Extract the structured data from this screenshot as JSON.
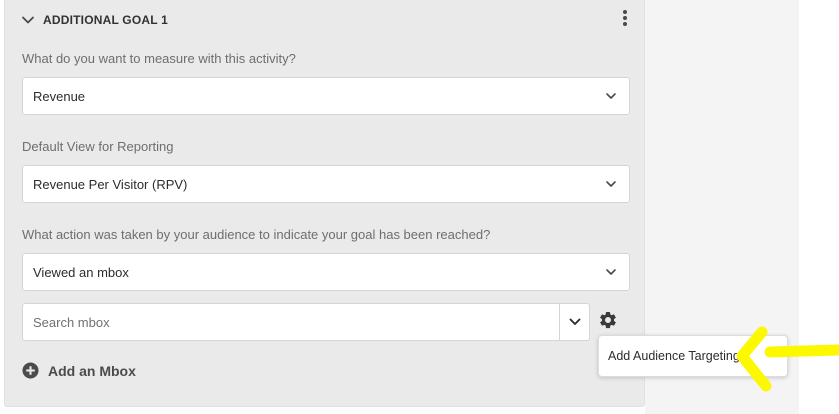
{
  "goal": {
    "title": "ADDITIONAL GOAL 1"
  },
  "fields": {
    "measure": {
      "label": "What do you want to measure with this activity?",
      "value": "Revenue"
    },
    "reporting_view": {
      "label": "Default View for Reporting",
      "value": "Revenue Per Visitor (RPV)"
    },
    "audience_action": {
      "label": "What action was taken by your audience to indicate your goal has been reached?",
      "value": "Viewed an mbox"
    }
  },
  "search": {
    "placeholder": "Search mbox"
  },
  "add_mbox": {
    "label": "Add an Mbox"
  },
  "popover": {
    "item_label": "Add Audience Targeting"
  },
  "colors": {
    "panel_bg": "#eaeaea",
    "highlight": "#ffff00",
    "text_primary": "#2c2c2c",
    "label_gray": "#6e6e6e"
  },
  "icons": {
    "collapse": "chevron-down-icon",
    "more": "more-vertical-icon",
    "dropdown": "chevron-down-icon",
    "settings": "gear-icon",
    "add": "plus-circle-icon",
    "annotation": "arrow-left-icon"
  }
}
